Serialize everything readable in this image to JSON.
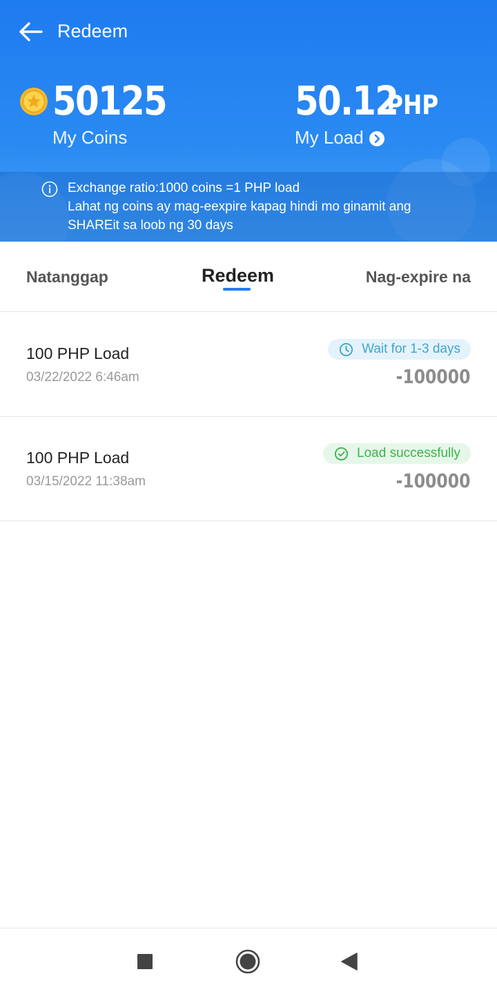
{
  "header": {
    "title": "Redeem",
    "coins_value": "50125",
    "coins_label": "My Coins",
    "load_value": "50.12",
    "load_unit": "PHP",
    "load_label": "My Load",
    "info_lines": [
      "Exchange ratio:1000 coins =1 PHP load",
      "Lahat ng coins ay mag-eexpire kapag hindi mo ginamit ang",
      "SHAREit sa loob ng 30 days"
    ]
  },
  "tabs": [
    {
      "label": "Natanggap",
      "active": false
    },
    {
      "label": "Redeem",
      "active": true
    },
    {
      "label": "Nag-expire na",
      "active": false
    }
  ],
  "records": [
    {
      "title": "100 PHP Load",
      "date": "03/22/2022 6:46am",
      "status": "Wait for 1-3 days",
      "status_type": "waiting",
      "amount": "-100000"
    },
    {
      "title": "100 PHP Load",
      "date": "03/15/2022 11:38am",
      "status": "Load successfully",
      "status_type": "success",
      "amount": "-100000"
    }
  ],
  "colors": {
    "header_blue": "#1f7bf0",
    "accent": "#1f7bf0",
    "waiting_text": "#3fa6c9",
    "success_text": "#3cb44b",
    "amount_gray": "#8c8c8c"
  },
  "icons": {
    "back": "back-arrow-icon",
    "coin": "coin-icon",
    "load_link": "chevron-right-circle-icon",
    "info": "info-icon",
    "waiting": "clock-icon",
    "success": "check-circle-icon",
    "nav": [
      "recents-square-icon",
      "home-circle-icon",
      "back-triangle-icon"
    ]
  }
}
